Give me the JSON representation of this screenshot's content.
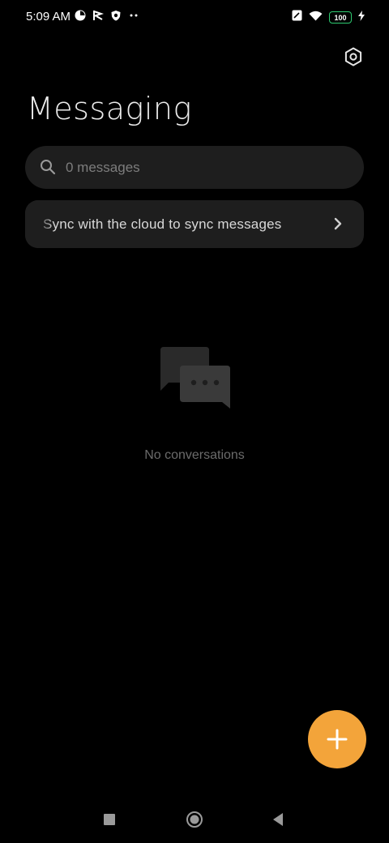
{
  "status_bar": {
    "time": "5:09 AM",
    "battery_level": "100",
    "left_icons": [
      "app-notification-icon",
      "flag-icon",
      "shield-icon",
      "more-dots-icon"
    ],
    "right_icons": [
      "note-icon",
      "wifi-icon",
      "battery-icon",
      "charging-icon"
    ],
    "battery_color": "#2ecc71"
  },
  "header": {
    "title": "Messaging",
    "settings_icon": "gear-icon"
  },
  "search": {
    "placeholder": "0 messages",
    "icon": "search-icon"
  },
  "sync_banner": {
    "text": "Sync with the cloud to sync messages",
    "icon": "chevron-right-icon"
  },
  "empty_state": {
    "icon": "chat-bubbles-icon",
    "text": "No conversations"
  },
  "fab": {
    "icon": "plus-icon",
    "color": "#f3a43a"
  },
  "nav_bar": {
    "buttons": [
      "recents-button",
      "home-button",
      "back-button"
    ]
  },
  "colors": {
    "background": "#000000",
    "surface": "#1e1e1e",
    "accent": "#f3a43a"
  }
}
